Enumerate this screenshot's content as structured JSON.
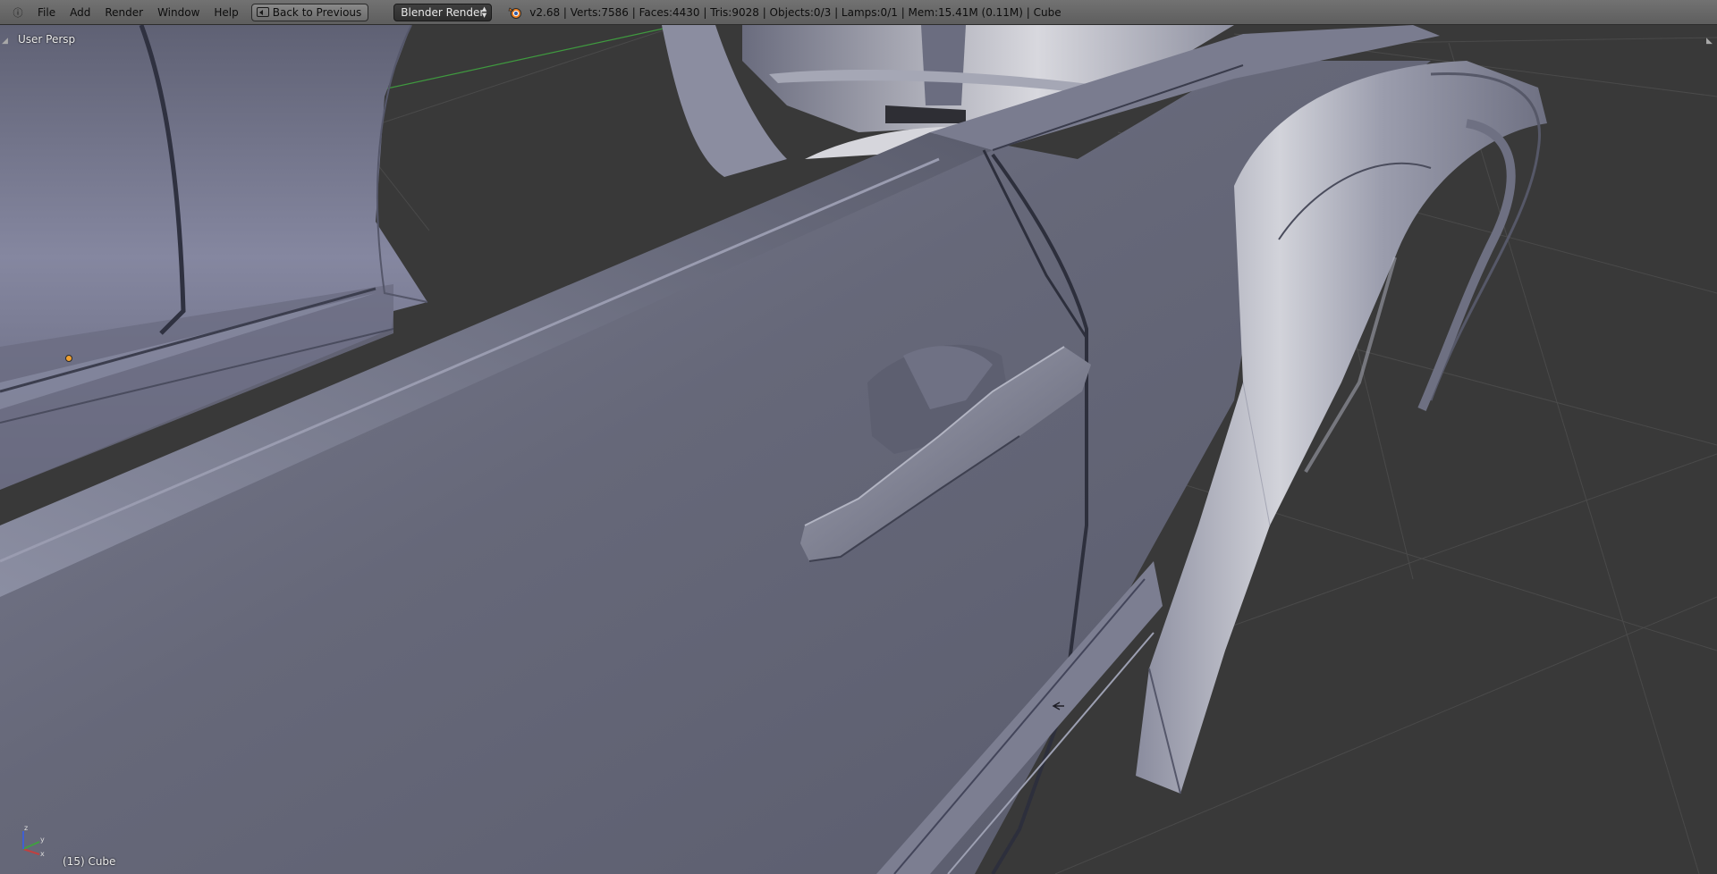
{
  "header": {
    "editor_icon": "info-editor-icon",
    "menus": [
      "File",
      "Add",
      "Render",
      "Window",
      "Help"
    ],
    "back_button_label": "Back to Previous",
    "render_engine": "Blender Render",
    "stats": "v2.68 | Verts:7586 | Faces:4430 | Tris:9028 | Objects:0/3 | Lamps:0/1 | Mem:15.41M (0.11M) | Cube"
  },
  "viewport": {
    "view_name": "User Persp",
    "object_info": "(15) Cube",
    "axis_labels": {
      "x": "x",
      "y": "y",
      "z": "z"
    }
  },
  "colors": {
    "header_bg": "#6a6a6a",
    "viewport_bg": "#393939",
    "mesh_base": "#6f7186",
    "mesh_highlight": "#c9c9d2",
    "x_axis": "#b34040",
    "y_axis_line": "#3f9a3f",
    "z_axis": "#4060c8",
    "origin": "#f0a030"
  }
}
